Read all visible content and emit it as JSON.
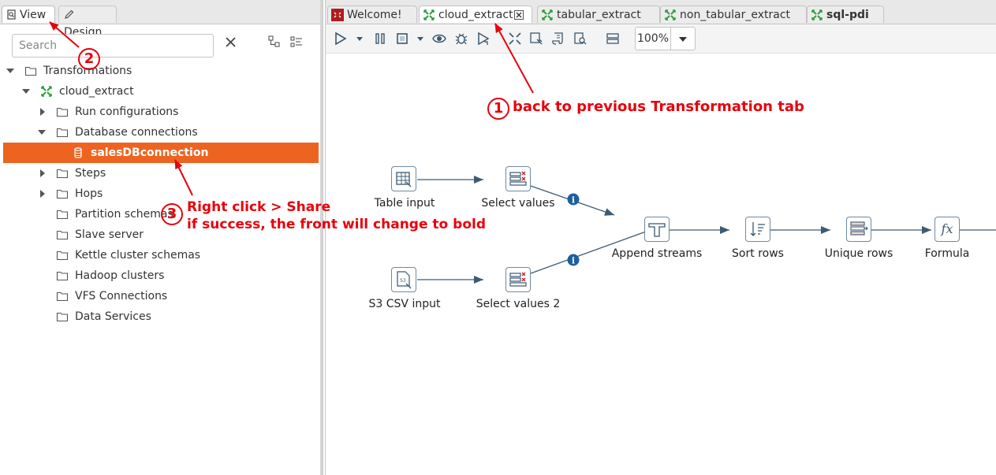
{
  "left_panel": {
    "tabs": [
      {
        "label": "View",
        "icon": "view-icon"
      },
      {
        "label": "Design",
        "icon": "pencil-icon"
      }
    ],
    "search": {
      "placeholder": "Search",
      "value": ""
    },
    "tree": [
      {
        "label": "Transformations",
        "level": 0,
        "expanded": true,
        "icon": "folder-icon"
      },
      {
        "label": "cloud_extract",
        "level": 1,
        "expanded": true,
        "icon": "transformation-icon"
      },
      {
        "label": "Run configurations",
        "level": 2,
        "expanded": false,
        "icon": "folder-icon"
      },
      {
        "label": "Database connections",
        "level": 2,
        "expanded": true,
        "icon": "folder-icon"
      },
      {
        "label": "salesDBconnection",
        "level": 3,
        "selected": true,
        "icon": "database-icon"
      },
      {
        "label": "Steps",
        "level": 2,
        "expanded": false,
        "icon": "folder-icon"
      },
      {
        "label": "Hops",
        "level": 2,
        "expanded": false,
        "icon": "folder-icon"
      },
      {
        "label": "Partition schemas",
        "level": 2,
        "icon": "folder-icon"
      },
      {
        "label": "Slave server",
        "level": 2,
        "icon": "folder-icon"
      },
      {
        "label": "Kettle cluster schemas",
        "level": 2,
        "icon": "folder-icon"
      },
      {
        "label": "Hadoop clusters",
        "level": 2,
        "icon": "folder-icon"
      },
      {
        "label": "VFS Connections",
        "level": 2,
        "icon": "folder-icon"
      },
      {
        "label": "Data Services",
        "level": 2,
        "icon": "folder-icon"
      }
    ]
  },
  "editor_tabs": [
    {
      "label": "Welcome!",
      "icon": "welcome-icon"
    },
    {
      "label": "cloud_extract",
      "icon": "transformation-icon",
      "active": true,
      "closable": true
    },
    {
      "label": "tabular_extract",
      "icon": "transformation-icon"
    },
    {
      "label": "non_tabular_extract",
      "icon": "transformation-icon"
    },
    {
      "label": "sql-pdi",
      "icon": "transformation-icon",
      "bold": true
    }
  ],
  "toolbar": {
    "zoom": "100%"
  },
  "steps": [
    {
      "label": "Table input",
      "icon": "table-input-icon"
    },
    {
      "label": "Select values",
      "icon": "select-values-icon"
    },
    {
      "label": "S3 CSV input",
      "icon": "s3-csv-icon"
    },
    {
      "label": "Select values 2",
      "icon": "select-values-icon"
    },
    {
      "label": "Append streams",
      "icon": "append-streams-icon"
    },
    {
      "label": "Sort rows",
      "icon": "sort-rows-icon"
    },
    {
      "label": "Unique rows",
      "icon": "unique-rows-icon"
    },
    {
      "label": "Formula",
      "icon": "formula-icon",
      "icon_text": "fx"
    }
  ],
  "annotations": {
    "a1": {
      "number": "1",
      "text": "back to previous Transformation tab"
    },
    "a2": {
      "number": "2"
    },
    "a3": {
      "number": "3",
      "line1": "Right click > Share",
      "line2": "if success, the front will change to bold"
    }
  },
  "colors": {
    "selection": "#ed6421",
    "annotation": "#e8000b",
    "hop": "#3d5a72",
    "info": "#1d5f9e"
  }
}
